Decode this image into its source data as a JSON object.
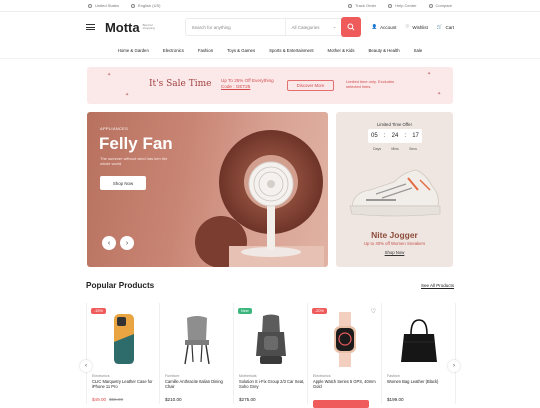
{
  "topbar": {
    "country": "United States",
    "language": "English (US)",
    "track": "Track Order",
    "help": "Help Center",
    "compare": "Compare"
  },
  "header": {
    "logo": "Motta",
    "tagline": "Best for shopping",
    "search_placeholder": "Search for anything",
    "category": "All Categories",
    "account": "Account",
    "wishlist": "Wishlist",
    "wishlist_count": "0",
    "cart": "Cart",
    "cart_count": "0"
  },
  "nav": [
    "Home & Garden",
    "Electronics",
    "Fashion",
    "Toys & Games",
    "Sports & Entertainment",
    "Mother & Kids",
    "Beauty & Health",
    "Sale"
  ],
  "sale": {
    "title": "It's Sale Time",
    "offer": "Up To 25% Off Everything",
    "code": "Code : GET25",
    "button": "Discover More",
    "note": "Limited time only. Excludes selected lines."
  },
  "hero": {
    "tag": "APPLIANCES",
    "title": "Felly Fan",
    "text": "The summer without wind has ken the whole world.",
    "button": "Shop Now",
    "prev": "‹",
    "next": "›"
  },
  "limited": {
    "title": "Limited Time Offer",
    "days": "05",
    "mins": "24",
    "secs": "17",
    "days_label": "Days",
    "mins_label": "Mins",
    "secs_label": "Secs",
    "product": "Nite Jogger",
    "subtitle": "Up to 40% off Women Sneakers",
    "button": "Shop Now"
  },
  "popular": {
    "title": "Popular Products",
    "view_all": "See All Products",
    "products": [
      {
        "badge": "-15%",
        "badge_color": "#ef5b5b",
        "category": "Electronics",
        "name": "CLIC Marquetry Leather Case for iPhone 11 Pro",
        "price": "$49.00",
        "old": "$55.00"
      },
      {
        "badge": "",
        "badge_color": "",
        "category": "Furniture",
        "name": "Camille Anthracite Italian Dining Chair",
        "price": "$210.00",
        "old": ""
      },
      {
        "badge": "New",
        "badge_color": "#3bb77e",
        "category": "Motherkids",
        "name": "Solution S i-Fix Group 2/3 Car Seat, Soho Grey",
        "price": "$275.00",
        "old": ""
      },
      {
        "badge": "-20%",
        "badge_color": "#ef5b5b",
        "category": "Electronics",
        "name": "Apple Watch Series 5 GPS, 40mm Gold",
        "price": "",
        "old": ""
      },
      {
        "badge": "",
        "badge_color": "",
        "category": "Fashion",
        "name": "Women Bag Leather (Black)",
        "price": "$199.00",
        "old": ""
      }
    ]
  },
  "colors": {
    "accent": "#ef5b5b",
    "sale_bg": "#fbe9ea",
    "hero": "#c98574"
  }
}
